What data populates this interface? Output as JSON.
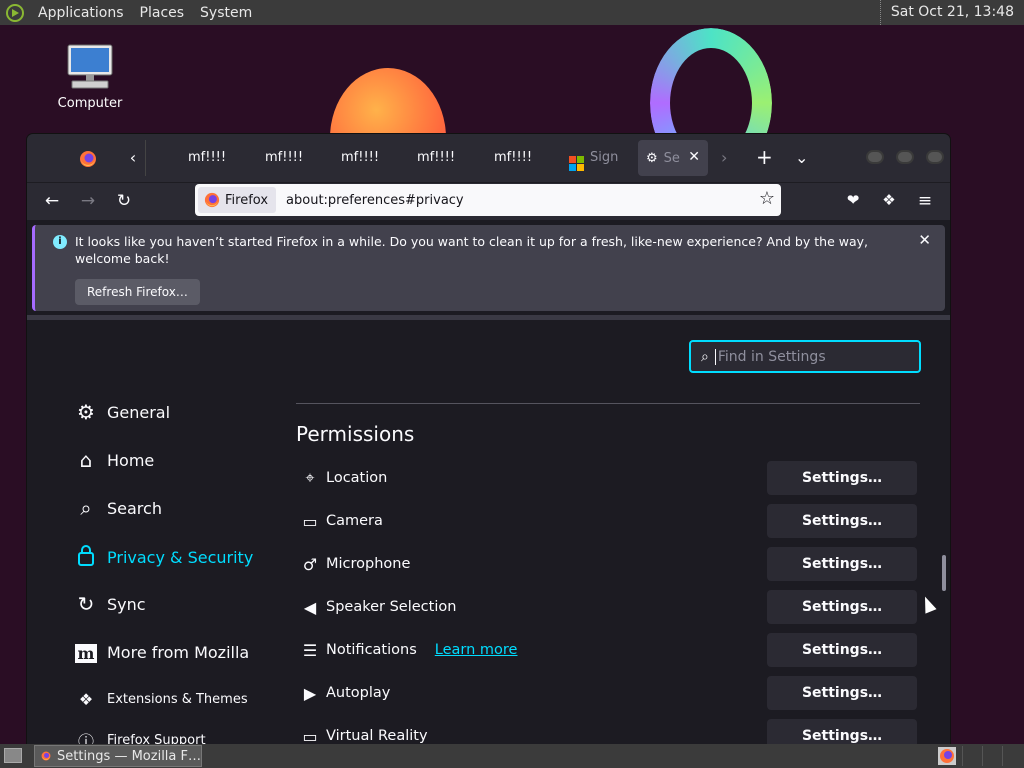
{
  "top_panel": {
    "menus": [
      "Applications",
      "Places",
      "System"
    ],
    "clock": "Sat Oct 21, 13:48"
  },
  "desktop": {
    "computer_label": "Computer"
  },
  "browser": {
    "tabs": [
      "mf!!!!",
      "mf!!!!",
      "mf!!!!",
      "mf!!!!",
      "mf!!!!"
    ],
    "ms_tab_label": "Sign",
    "active_tab_label": "Se",
    "url_chip": "Firefox",
    "url": "about:preferences#privacy",
    "notification": {
      "message": "It looks like you haven’t started Firefox in a while. Do you want to clean it up for a fresh, like-new experience? And by the way, welcome back!",
      "button": "Refresh Firefox…"
    },
    "search_placeholder": "Find in Settings",
    "categories": [
      {
        "label": "General",
        "icon": "gear-icon"
      },
      {
        "label": "Home",
        "icon": "home-icon"
      },
      {
        "label": "Search",
        "icon": "search-icon"
      },
      {
        "label": "Privacy & Security",
        "icon": "lock-icon"
      },
      {
        "label": "Sync",
        "icon": "sync-icon"
      },
      {
        "label": "More from Mozilla",
        "icon": "mozilla-icon"
      }
    ],
    "footer_links": [
      {
        "label": "Extensions & Themes",
        "icon": "puzzle-icon"
      },
      {
        "label": "Firefox Support",
        "icon": "help-icon"
      }
    ],
    "permissions": {
      "title": "Permissions",
      "button_label": "Settings…",
      "learn_more": "Learn more",
      "rows": [
        {
          "label": "Location",
          "icon": "location-icon"
        },
        {
          "label": "Camera",
          "icon": "camera-icon"
        },
        {
          "label": "Microphone",
          "icon": "microphone-icon"
        },
        {
          "label": "Speaker Selection",
          "icon": "speaker-icon"
        },
        {
          "label": "Notifications",
          "icon": "notification-icon"
        },
        {
          "label": "Autoplay",
          "icon": "autoplay-icon"
        },
        {
          "label": "Virtual Reality",
          "icon": "vr-icon"
        }
      ]
    }
  },
  "bottom_panel": {
    "task_label": "Settings — Mozilla F…"
  },
  "colors": {
    "accent": "#00ddff",
    "window_bg": "#1c1b22",
    "toolbar_bg": "#2b2a33"
  }
}
